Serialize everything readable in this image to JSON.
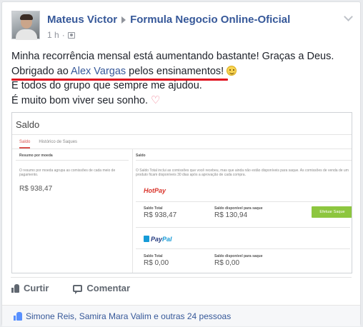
{
  "header": {
    "author": "Mateus Victor",
    "group": "Formula Negocio Online-Oficial",
    "time": "1 h",
    "separator": "·"
  },
  "post": {
    "line1": "Minha recorrência mensal está aumentando bastante! Graças a Deus.",
    "line2_pre": "Obrigado ao ",
    "line2_link": "Alex Vargas",
    "line2_post": " pelos ensinamentos!",
    "line3": "E todos do grupo que sempre me ajudou.",
    "line4": "É muito bom viver seu sonho."
  },
  "embed": {
    "title": "Saldo",
    "tab_active": "Saldo",
    "tab_other": "Histórico de Saques",
    "left_col_title": "Resumo por moeda",
    "right_col_title": "Saldo",
    "left_desc": "O resumo por moeda agrupa as comissões de cada meio de pagamento.",
    "left_value": "R$ 938,47",
    "right_desc": "O Saldo Total inclui as comissões que você recebeu, mas que ainda não estão disponíveis para saque. As comissões de venda de um produto ficam disponíveis 30 dias após a aprovação de cada compra.",
    "hotpay_name": "HotPay",
    "hotpay_total_label": "Saldo Total",
    "hotpay_total": "R$ 938,47",
    "hotpay_avail_label": "Saldo disponível para saque",
    "hotpay_avail": "R$ 130,94",
    "withdraw_button": "Efetuar Saque",
    "paypal_name_a": "Pay",
    "paypal_name_b": "Pal",
    "paypal_total_label": "Saldo Total",
    "paypal_total": "R$ 0,00",
    "paypal_avail_label": "Saldo disponível para saque",
    "paypal_avail": "R$ 0,00"
  },
  "actions": {
    "like": "Curtir",
    "comment": "Comentar"
  },
  "likes": {
    "text": "Simone Reis, Samira Mara Valim e outras 24 pessoas"
  },
  "colors": {
    "link": "#365899",
    "underline": "#e0131f",
    "button_green": "#8dc63f"
  },
  "icons": [
    "avatar",
    "chevron-down-icon",
    "audience-icon",
    "smiley-icon",
    "heart-icon",
    "like-icon",
    "comment-icon",
    "likes-thumb-icon"
  ]
}
